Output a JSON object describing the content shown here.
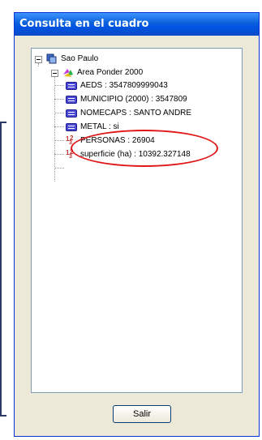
{
  "window": {
    "title": "Consulta en el cuadro",
    "title_bar_color": "#0054e3"
  },
  "tree": {
    "root": {
      "label": "Sao Paulo"
    },
    "layer": {
      "label": "Area Ponder 2000"
    },
    "attributes": [
      {
        "label": "AEDS : 3547809999043",
        "icon": "field-icon"
      },
      {
        "label": "MUNICIPIO (2000) : 3547809",
        "icon": "field-icon"
      },
      {
        "label": "NOMECAPS : SANTO ANDRE",
        "icon": "field-icon"
      },
      {
        "label": "METAL : si",
        "icon": "field-icon"
      },
      {
        "label": "PERSONAS : 26904",
        "icon": "numeric-icon"
      },
      {
        "label": "superficie (ha) : 10392.327148",
        "icon": "numeric-icon"
      }
    ]
  },
  "buttons": {
    "salir": "Salir"
  },
  "annotation": {
    "color": "#e01818"
  }
}
